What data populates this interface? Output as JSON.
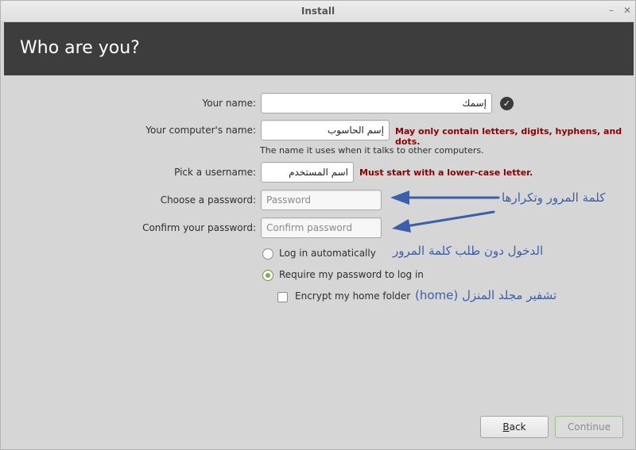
{
  "window": {
    "title": "Install"
  },
  "header": {
    "heading": "Who are you?"
  },
  "form": {
    "name_label": "Your name:",
    "name_value": "إسمك",
    "computer_label": "Your computer's name:",
    "computer_value": "إسم الحاسوب",
    "computer_error": "May only contain letters, digits, hyphens, and dots.",
    "computer_hint": "The name it uses when it talks to other computers.",
    "username_label": "Pick a username:",
    "username_value": "اسم المستخدم",
    "username_error": "Must start with a lower-case letter.",
    "password_label": "Choose a password:",
    "password_placeholder": "Password",
    "confirm_label": "Confirm your password:",
    "confirm_placeholder": "Confirm password"
  },
  "options": {
    "auto_login": {
      "label": "Log in automatically",
      "selected": false
    },
    "require_password": {
      "label": "Require my password to log in",
      "selected": true
    },
    "encrypt_home": {
      "label": "Encrypt my home folder",
      "checked": false
    }
  },
  "annotations": {
    "password": "كلمة المرور وتكرارها",
    "auto_login": "الدخول دون طلب كلمة المرور",
    "encrypt": "تشفير مجلد المنزل (home)"
  },
  "buttons": {
    "back_mnemonic": "B",
    "back_rest": "ack",
    "continue": "Continue"
  },
  "colors": {
    "header_bg": "#3d3d3d",
    "error": "#8b0000",
    "annotation": "#3b5fa8",
    "radio_accent": "#7fb041"
  },
  "icons": {
    "valid": "check-circle-icon",
    "minimize": "minimize-icon",
    "close": "close-icon"
  }
}
